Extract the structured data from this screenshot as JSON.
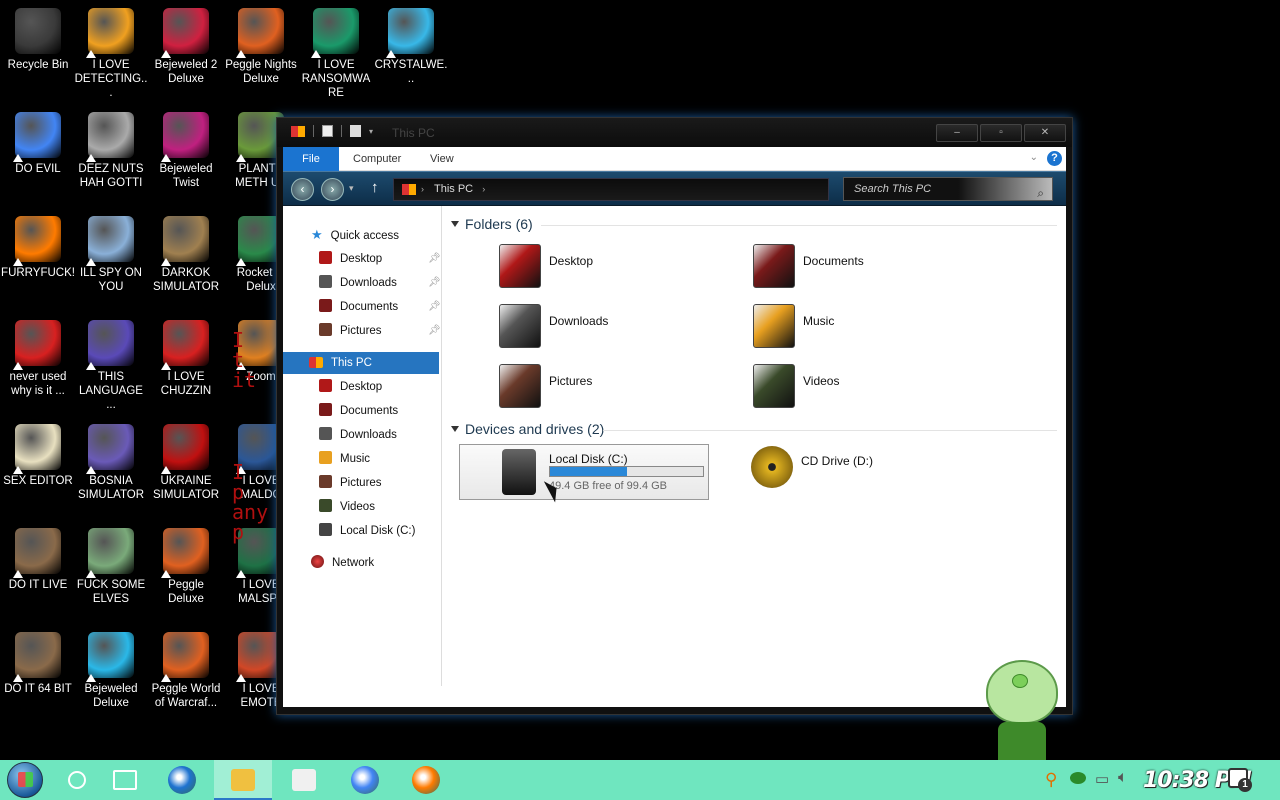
{
  "desktop": {
    "icons": [
      {
        "label": "Recycle Bin",
        "color": "#3a3a3a"
      },
      {
        "label": "I LOVE DETECTING...",
        "color": "#f0a020"
      },
      {
        "label": "Bejeweled 2 Deluxe",
        "color": "#d02040"
      },
      {
        "label": "Peggle Nights Deluxe",
        "color": "#e06020"
      },
      {
        "label": "I LOVE RANSOMWARE",
        "color": "#1a9a6a"
      },
      {
        "label": "CRYSTALWE...",
        "color": "#38b8e8"
      },
      {
        "label": "DO EVIL",
        "color": "#4285f4"
      },
      {
        "label": "DEEZ NUTS HAH GOTTI",
        "color": "#aaaaaa"
      },
      {
        "label": "Bejeweled Twist",
        "color": "#c02080"
      },
      {
        "label": "PLANTS METH US",
        "color": "#6a9a3a"
      },
      {
        "label": "FURRYFUCK!",
        "color": "#ff7b00"
      },
      {
        "label": "ILL SPY ON YOU",
        "color": "#8ab0d8"
      },
      {
        "label": "DARKOK SIMULATOR",
        "color": "#a08050"
      },
      {
        "label": "Rocket M Delux",
        "color": "#2a8a4a"
      },
      {
        "label": "never used why is it ...",
        "color": "#d82020"
      },
      {
        "label": "THIS LANGUAGE ...",
        "color": "#5a4ab8"
      },
      {
        "label": "I LOVE CHUZZIN",
        "color": "#d82020"
      },
      {
        "label": "Zoom",
        "color": "#e08020"
      },
      {
        "label": "SEX EDITOR",
        "color": "#e8e0c0"
      },
      {
        "label": "BOSNIA SIMULATOR",
        "color": "#6a5ab8"
      },
      {
        "label": "UKRAINE SIMULATOR",
        "color": "#c01010"
      },
      {
        "label": "I LOVE MALDO",
        "color": "#2b5797"
      },
      {
        "label": "DO IT LIVE",
        "color": "#8a6a4a"
      },
      {
        "label": "FUCK SOME ELVES",
        "color": "#7aaa7a"
      },
      {
        "label": "Peggle Deluxe",
        "color": "#e06020"
      },
      {
        "label": "I LOVE MALSPA",
        "color": "#1e7145"
      },
      {
        "label": "DO IT 64 BIT",
        "color": "#8a6a4a"
      },
      {
        "label": "Bejeweled Deluxe",
        "color": "#2ab8e8"
      },
      {
        "label": "Peggle World of Warcraf...",
        "color": "#e06020"
      },
      {
        "label": "I LOVE EMOTE",
        "color": "#d24726"
      }
    ]
  },
  "window": {
    "title": "This PC",
    "ribbon": {
      "file": "File",
      "computer": "Computer",
      "view": "View",
      "help": "?"
    },
    "address": "This PC",
    "search_placeholder": "Search This PC",
    "nav": {
      "quick_access": "Quick access",
      "quick_items": [
        "Desktop",
        "Downloads",
        "Documents",
        "Pictures"
      ],
      "this_pc": "This PC",
      "pc_items": [
        "Desktop",
        "Documents",
        "Downloads",
        "Music",
        "Pictures",
        "Videos",
        "Local Disk (C:)"
      ],
      "network": "Network"
    },
    "folders_header": "Folders (6)",
    "folders": [
      {
        "name": "Desktop",
        "color": "#b01818"
      },
      {
        "name": "Documents",
        "color": "#7a1a1a"
      },
      {
        "name": "Downloads",
        "color": "#555555"
      },
      {
        "name": "Music",
        "color": "#e8a020"
      },
      {
        "name": "Pictures",
        "color": "#6a3a2a"
      },
      {
        "name": "Videos",
        "color": "#3a4a2a"
      }
    ],
    "drives_header": "Devices and drives (2)",
    "local_disk": {
      "name": "Local Disk (C:)",
      "free": "49.4 GB free of 99.4 GB",
      "used_fraction": 0.503
    },
    "cd_drive": {
      "name": "CD Drive (D:)"
    }
  },
  "taskbar": {
    "clock": "10:38 PM",
    "notification_count": "1",
    "apps": [
      {
        "name": "search",
        "color": "#ffffff"
      },
      {
        "name": "task-view",
        "color": "#ffffff"
      },
      {
        "name": "edge",
        "color": "#1e73d0"
      },
      {
        "name": "file-explorer",
        "color": "#f0c040"
      },
      {
        "name": "store",
        "color": "#f0f0f0"
      },
      {
        "name": "chrome",
        "color": "#4285f4"
      },
      {
        "name": "firefox",
        "color": "#ff7b00"
      }
    ]
  },
  "background_text": "I t it I y any I"
}
